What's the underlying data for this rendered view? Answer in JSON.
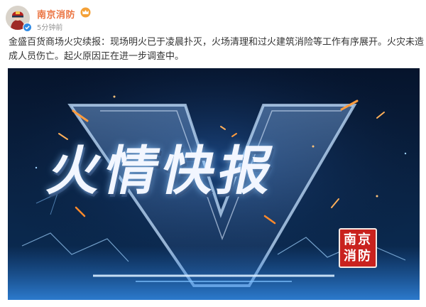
{
  "post": {
    "author": "南京消防",
    "time": "5分钟前",
    "text_line1": "金盛百货商场火灾续报：现场明火已于凌晨扑灭，火场清理和过火建筑消险等工作有序展开。火灾未造",
    "text_line2": "成人员伤亡。起火原因正在进一步调查中。"
  },
  "banner": {
    "headline": "火情快报",
    "stamp_line1": "南京",
    "stamp_line2": "消防"
  },
  "colors": {
    "author": "#eb7340",
    "text": "#333333",
    "time": "#939393",
    "stamp": "#c9221e",
    "banner_bg": "#06142c"
  },
  "icons": {
    "verified": "verified-badge-icon",
    "vip": "vip-crown-icon"
  }
}
